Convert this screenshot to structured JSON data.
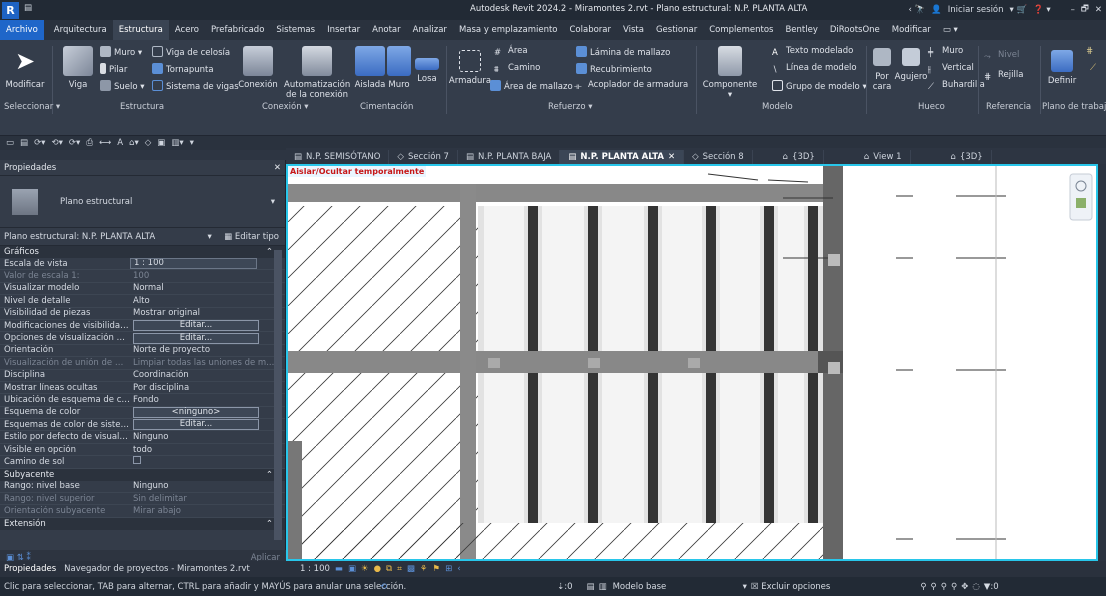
{
  "titlebar": {
    "logo": "R",
    "title": "Autodesk Revit 2024.2 - Miramontes 2.rvt - Plano estructural: N.P. PLANTA ALTA",
    "signin": "Iniciar sesión"
  },
  "menu": [
    "Archivo",
    "Arquitectura",
    "Estructura",
    "Acero",
    "Prefabricado",
    "Sistemas",
    "Insertar",
    "Anotar",
    "Analizar",
    "Masa y emplazamiento",
    "Colaborar",
    "Vista",
    "Gestionar",
    "Complementos",
    "Bentley",
    "DiRootsOne",
    "Modificar"
  ],
  "menu_active": "Estructura",
  "ribbon": {
    "modificar": "Modificar",
    "viga": "Viga",
    "muro": "Muro",
    "pilar": "Pilar",
    "suelo": "Suelo",
    "viga_celosia": "Viga de celosía",
    "tornapunta": "Tornapunta",
    "sistema_vigas": "Sistema de vigas",
    "conexion": "Conexión",
    "automatizacion": "Automatización",
    "de_la_conexion": "de la conexión",
    "aislada": "Aislada",
    "muro2": "Muro",
    "losa": "Losa",
    "armadura": "Armadura",
    "area": "Área",
    "camino": "Camino",
    "lamina": "Lámina de mallazo",
    "recubrimiento": "Recubrimiento",
    "area_mallazo": "Área de mallazo",
    "acoplador": "Acoplador de armadura",
    "componente": "Componente",
    "texto_modelado": "Texto modelado",
    "linea_modelo": "Línea de modelo",
    "grupo_modelo": "Grupo de modelo",
    "por_cara": "Por cara",
    "agujero": "Agujero",
    "muro3": "Muro",
    "vertical": "Vertical",
    "buhardilla": "Buhardilla",
    "nivel": "Nivel",
    "rejilla": "Rejilla",
    "definir": "Definir",
    "groups": {
      "seleccionar": "Seleccionar ▾",
      "estructura": "Estructura",
      "conexion": "Conexión ▾",
      "cimentacion": "Cimentación",
      "refuerzo": "Refuerzo ▾",
      "modelo": "Modelo",
      "hueco": "Hueco",
      "referencia": "Referencia",
      "plano_trabajo": "Plano de trabajo"
    }
  },
  "properties": {
    "header": "Propiedades",
    "type_name": "Plano estructural",
    "selector": "Plano estructural: N.P. PLANTA ALTA",
    "edit_type": "Editar tipo",
    "cat_graficos": "Gráficos",
    "rows": [
      {
        "k": "Escala de vista",
        "v": "1 : 100",
        "dim": false,
        "box": true
      },
      {
        "k": "Valor de escala    1:",
        "v": "100",
        "dim": true
      },
      {
        "k": "Visualizar modelo",
        "v": "Normal"
      },
      {
        "k": "Nivel de detalle",
        "v": "Alto"
      },
      {
        "k": "Visibilidad de piezas",
        "v": "Mostrar original"
      },
      {
        "k": "Modificaciones de visibilidad...",
        "v": "Editar...",
        "btn": true
      },
      {
        "k": "Opciones de visualización de ...",
        "v": "Editar...",
        "btn": true
      },
      {
        "k": "Orientación",
        "v": "Norte de proyecto"
      },
      {
        "k": "Visualización de unión de mu...",
        "v": "Limpiar todas las uniones de m...",
        "dim": true
      },
      {
        "k": "Disciplina",
        "v": "Coordinación"
      },
      {
        "k": "Mostrar líneas ocultas",
        "v": "Por disciplina"
      },
      {
        "k": "Ubicación de esquema de col...",
        "v": "Fondo"
      },
      {
        "k": "Esquema de color",
        "v": "<ninguno>",
        "btn": true
      },
      {
        "k": "Esquemas de color de sistema",
        "v": "Editar...",
        "btn": true
      },
      {
        "k": "Estilo por defecto de visualiz...",
        "v": "Ninguno"
      },
      {
        "k": "Visible en opción",
        "v": "todo"
      },
      {
        "k": "Camino de sol",
        "v": "",
        "chk": true
      }
    ],
    "cat_subyacente": "Subyacente",
    "rows2": [
      {
        "k": "Rango: nivel base",
        "v": "Ninguno"
      },
      {
        "k": "Rango: nivel superior",
        "v": "Sin delimitar",
        "dim": true
      },
      {
        "k": "Orientación subyacente",
        "v": "Mirar abajo",
        "dim": true
      }
    ],
    "cat_extension": "Extensión",
    "apply": "Aplicar",
    "tab_props": "Propiedades",
    "tab_browser": "Navegador de proyectos - Miramontes 2.rvt"
  },
  "view_tabs": [
    {
      "label": "N.P. SEMISÓTANO",
      "active": false
    },
    {
      "label": "Sección 7",
      "active": false
    },
    {
      "label": "N.P. PLANTA BAJA",
      "active": false
    },
    {
      "label": "N.P. PLANTA ALTA",
      "active": true
    },
    {
      "label": "Sección 8",
      "active": false
    },
    {
      "label": "{3D}",
      "active": false
    },
    {
      "label": "View 1",
      "active": false
    },
    {
      "label": "{3D}",
      "active": false
    }
  ],
  "canvas": {
    "isolate_label": "Aislar/Ocultar temporalmente"
  },
  "view_control": {
    "scale": "1 : 100"
  },
  "status": {
    "message": "Clic para seleccionar, TAB para alternar, CTRL para añadir y MAYÚS para anular una selección.",
    "zero": ":0",
    "model": "Modelo base",
    "exclude": "Excluir opciones",
    "filter": ":0"
  },
  "colors": {
    "accent": "#1f66c9",
    "canvas_border": "#28c6ea",
    "isolate_text": "#c71717"
  }
}
